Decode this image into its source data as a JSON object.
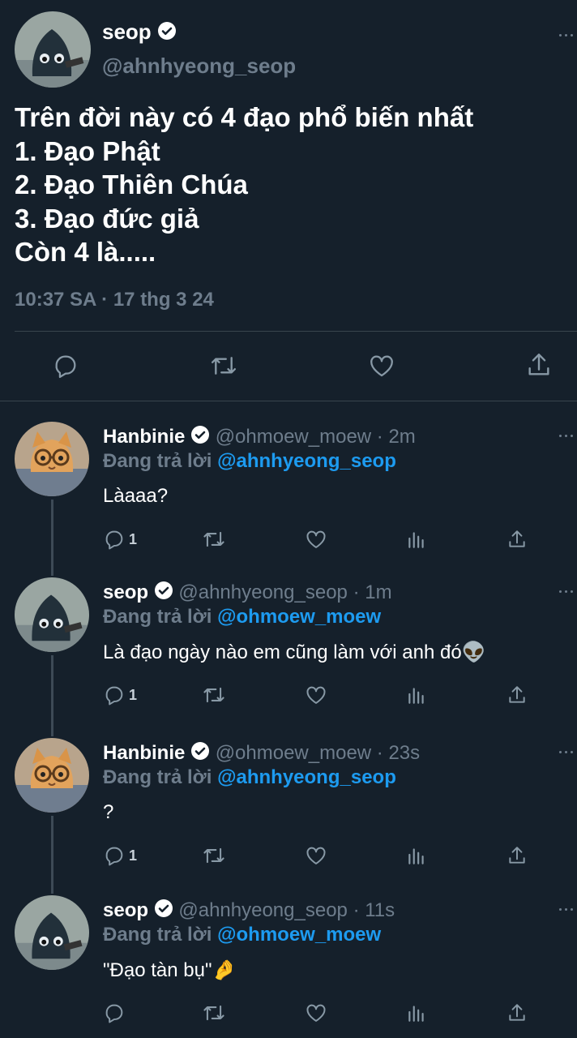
{
  "main_tweet": {
    "name": "seop",
    "handle": "@ahnhyeong_seop",
    "text": "Trên đời này có 4 đạo phổ biến nhất\n1. Đạo Phật\n2. Đạo Thiên Chúa\n3. Đạo đức giả\nCòn 4 là.....",
    "timestamp": "10:37 SA · 17 thg 3 24"
  },
  "replies": [
    {
      "name": "Hanbinie",
      "handle": "@ohmoew_moew · 2m",
      "replying_prefix": "Đang trả lời ",
      "replying_to": "@ahnhyeong_seop",
      "text": "Làaaa?",
      "reply_count": "1",
      "avatar": "cat"
    },
    {
      "name": "seop",
      "handle": "@ahnhyeong_seop · 1m",
      "replying_prefix": "Đang trả lời ",
      "replying_to": "@ohmoew_moew",
      "text": "Là đạo ngày nào em cũng làm với anh đó👽",
      "reply_count": "1",
      "avatar": "seop"
    },
    {
      "name": "Hanbinie",
      "handle": "@ohmoew_moew · 23s",
      "replying_prefix": "Đang trả lời ",
      "replying_to": "@ahnhyeong_seop",
      "text": "?",
      "reply_count": "1",
      "avatar": "cat"
    },
    {
      "name": "seop",
      "handle": "@ahnhyeong_seop · 11s",
      "replying_prefix": "Đang trả lời ",
      "replying_to": "@ohmoew_moew",
      "text": "\"Đạo tàn bụ\"🤌",
      "reply_count": "",
      "avatar": "seop"
    }
  ],
  "icons": {
    "reply": "speech-bubble-icon",
    "retweet": "retweet-icon",
    "like": "heart-icon",
    "views": "bar-chart-icon",
    "share": "share-icon",
    "verified": "verified-badge-icon",
    "more": "more-dots-icon"
  },
  "colors": {
    "background": "#15202b",
    "mention": "#1d9bf0",
    "muted": "#6e7d8c",
    "separator": "#38444d"
  }
}
